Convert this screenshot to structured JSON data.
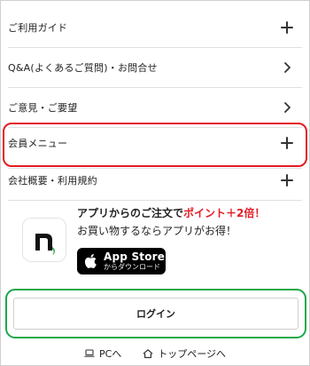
{
  "menu": {
    "items": [
      {
        "label": "ご利用ガイド",
        "icon": "plus-icon"
      },
      {
        "label": "Q&A(よくあるご質問)・お問合せ",
        "icon": "chevron-right-icon"
      },
      {
        "label": "ご意見・ご要望",
        "icon": "chevron-right-icon"
      },
      {
        "label": "会員メニュー",
        "icon": "plus-icon"
      },
      {
        "label": "会社概要・利用規約",
        "icon": "plus-icon"
      }
    ]
  },
  "app_promo": {
    "headline_prefix": "アプリからのご注文で",
    "headline_emphasis": "ポイント＋2倍！",
    "subtext": "お買い物するならアプリがお得！",
    "appstore": {
      "title": "App Store",
      "subtitle": "からダウンロード"
    },
    "colors": {
      "accent_red": "#e31b23",
      "logo_dark": "#111111",
      "logo_green": "#2ea84a"
    }
  },
  "login": {
    "label": "ログイン"
  },
  "footer": {
    "pc_label": "PCへ",
    "top_label": "トップページへ",
    "pc_icon": "laptop-icon",
    "top_icon": "home-icon"
  },
  "highlights": {
    "member_menu_color": "#e31b23",
    "login_color": "#1ca84a"
  }
}
